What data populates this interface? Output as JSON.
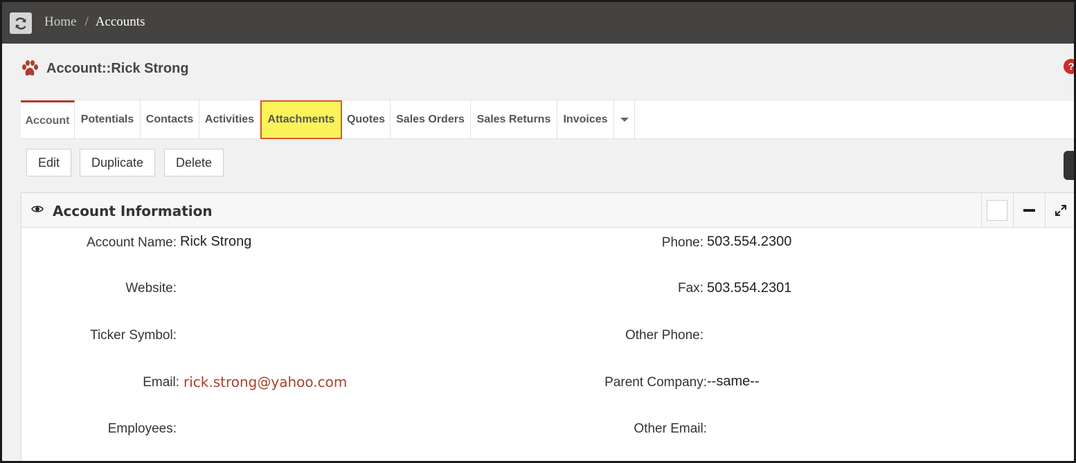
{
  "breadcrumb": {
    "home": "Home",
    "separator": "/",
    "current": "Accounts"
  },
  "header": {
    "title": "Account::Rick Strong",
    "module_icon": "paw-icon",
    "help_label": "?"
  },
  "tabs": [
    {
      "label": "Account"
    },
    {
      "label": "Potentials"
    },
    {
      "label": "Contacts"
    },
    {
      "label": "Activities"
    },
    {
      "label": "Attachments"
    },
    {
      "label": "Quotes"
    },
    {
      "label": "Sales Orders"
    },
    {
      "label": "Sales Returns"
    },
    {
      "label": "Invoices"
    }
  ],
  "actions": {
    "edit": "Edit",
    "duplicate": "Duplicate",
    "delete": "Delete"
  },
  "panel": {
    "title": "Account Information",
    "fields": {
      "account_name": {
        "label": "Account Name:",
        "value": "Rick Strong"
      },
      "website": {
        "label": "Website:",
        "value": ""
      },
      "ticker_symbol": {
        "label": "Ticker Symbol:",
        "value": ""
      },
      "email": {
        "label": "Email:",
        "value": "rick.strong@yahoo.com"
      },
      "employees": {
        "label": "Employees:",
        "value": ""
      },
      "phone": {
        "label": "Phone:",
        "value": "503.554.2300"
      },
      "fax": {
        "label": "Fax:",
        "value": "503.554.2301"
      },
      "other_phone": {
        "label": "Other Phone:",
        "value": ""
      },
      "parent_company": {
        "label": "Parent Company:",
        "value": "--same--"
      },
      "other_email": {
        "label": "Other Email:",
        "value": ""
      }
    }
  },
  "colors": {
    "topbar": "#444341",
    "accent": "#b23b2b",
    "highlight": "#faf45a",
    "highlight_border": "#e2562a",
    "link": "#a8422f"
  }
}
